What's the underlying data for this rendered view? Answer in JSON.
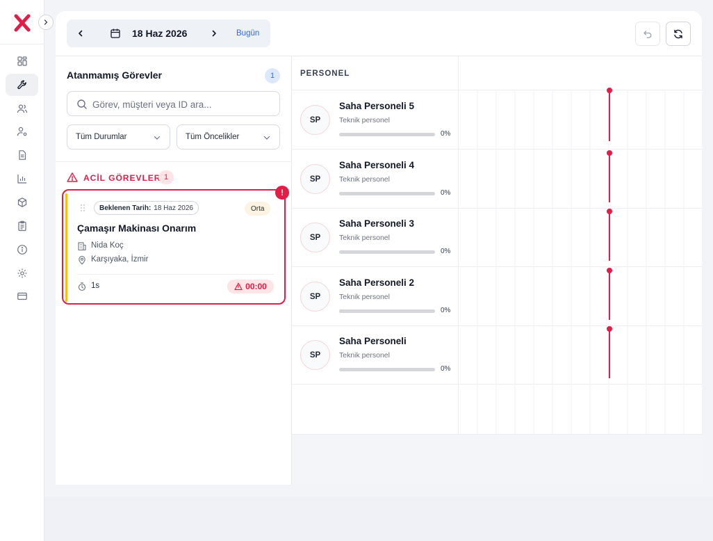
{
  "colors": {
    "accent": "#e11d48",
    "brand": "#e11d48",
    "link": "#2f6bd8",
    "urgent_card_stripe": "#f1c40f"
  },
  "sidebar": {
    "logo_icon": "x-logo-icon",
    "collapse_icon": "chevron-right-icon",
    "items": [
      {
        "icon": "dashboard-icon",
        "active": false
      },
      {
        "icon": "wrench-icon",
        "active": true
      },
      {
        "icon": "users-icon",
        "active": false
      },
      {
        "icon": "user-settings-icon",
        "active": false
      },
      {
        "icon": "document-icon",
        "active": false
      },
      {
        "icon": "bar-chart-icon",
        "active": false
      },
      {
        "icon": "package-icon",
        "active": false
      },
      {
        "icon": "clipboard-icon",
        "active": false
      },
      {
        "icon": "info-icon",
        "active": false
      },
      {
        "icon": "gear-icon",
        "active": false
      },
      {
        "icon": "credit-card-icon",
        "active": false
      }
    ]
  },
  "toolbar": {
    "date": "18 Haz 2026",
    "today_label": "Bugün",
    "prev_icon": "chevron-left-icon",
    "next_icon": "chevron-right-icon",
    "calendar_icon": "calendar-icon",
    "undo_icon": "undo-icon",
    "refresh_icon": "refresh-icon"
  },
  "unassigned": {
    "title": "Atanmamış Görevler",
    "count": "1",
    "search_placeholder": "Görev, müşteri veya ID ara...",
    "status_filter": "Tüm Durumlar",
    "priority_filter": "Tüm Öncelikler",
    "urgent_label": "ACİL GÖREVLER",
    "urgent_count": "1",
    "tasks": [
      {
        "expected_label": "Beklenen Tarih:",
        "expected_date": "18 Haz 2026",
        "priority": "Orta",
        "title": "Çamaşır Makinası Onarım",
        "customer": "Nida Koç",
        "location": "Karşıyaka, İzmir",
        "duration": "1s",
        "timer": "00:00",
        "alert": "!"
      }
    ]
  },
  "schedule": {
    "header": "PERSONEL",
    "staff": [
      {
        "initials": "SP",
        "name": "Saha Personeli 5",
        "role": "Teknik personel",
        "workload": 0,
        "workload_label": "0%"
      },
      {
        "initials": "SP",
        "name": "Saha Personeli 4",
        "role": "Teknik personel",
        "workload": 0,
        "workload_label": "0%"
      },
      {
        "initials": "SP",
        "name": "Saha Personeli 3",
        "role": "Teknik personel",
        "workload": 0,
        "workload_label": "0%"
      },
      {
        "initials": "SP",
        "name": "Saha Personeli 2",
        "role": "Teknik personel",
        "workload": 0,
        "workload_label": "0%"
      },
      {
        "initials": "SP",
        "name": "Saha Personeli",
        "role": "Teknik personel",
        "workload": 0,
        "workload_label": "0%"
      }
    ]
  }
}
